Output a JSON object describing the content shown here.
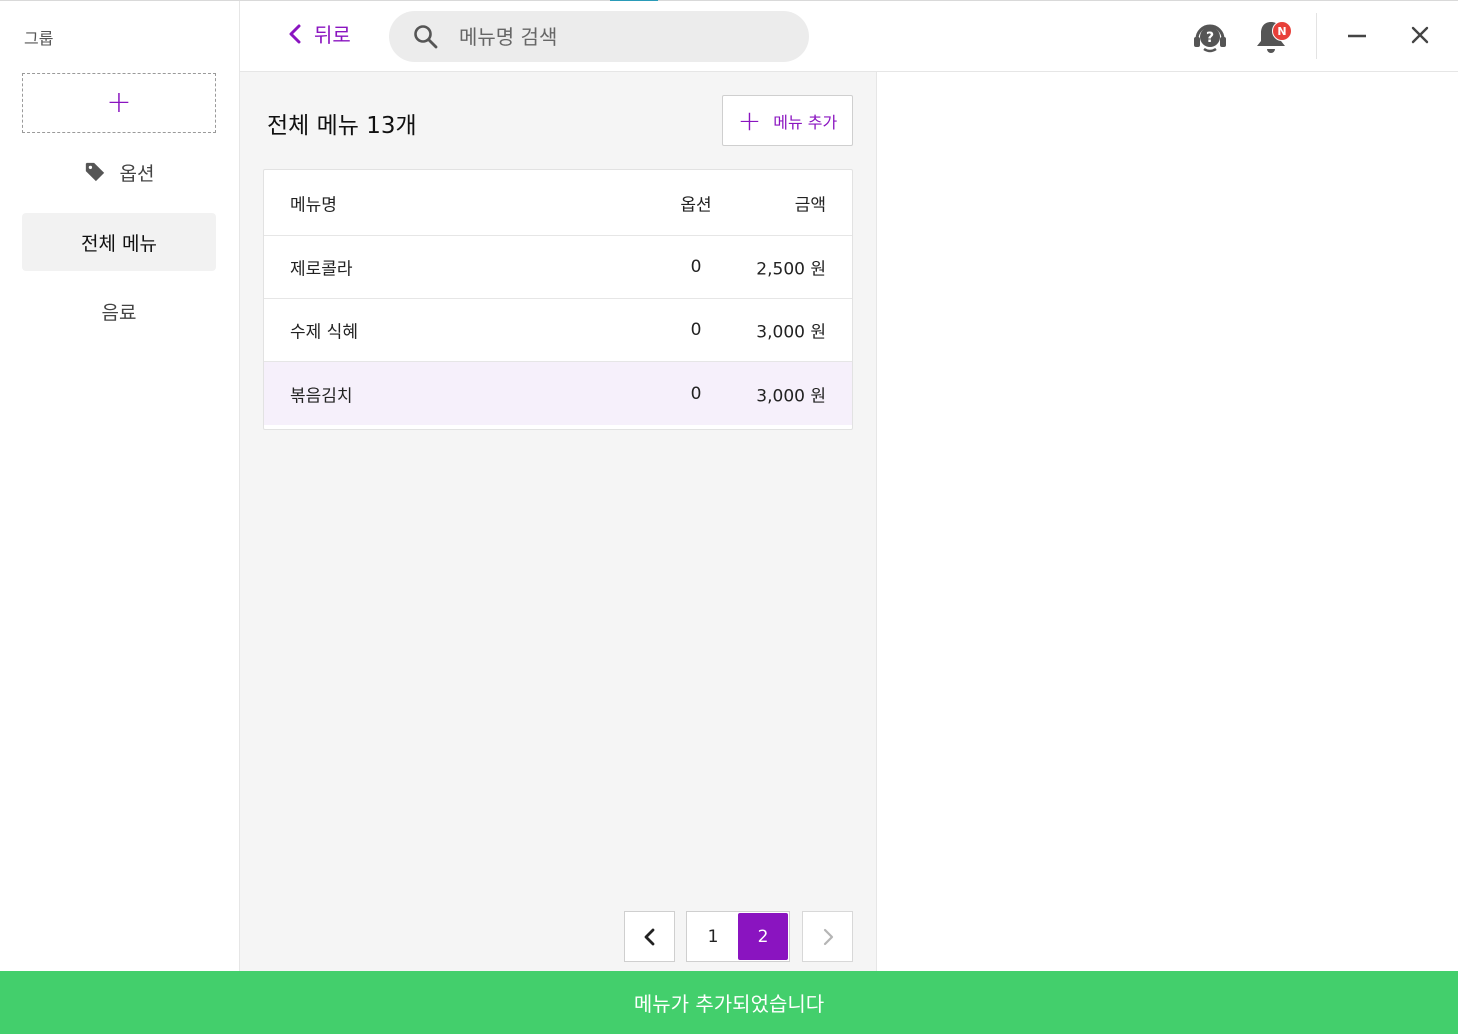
{
  "sidebar": {
    "title": "그룹",
    "add_label": "+",
    "items": [
      {
        "label": "옵션",
        "icon": "tag-icon"
      },
      {
        "label": "전체 메뉴",
        "active": true
      },
      {
        "label": "음료"
      }
    ]
  },
  "topbar": {
    "back_label": "뒤로",
    "search_placeholder": "메뉴명 검색",
    "notification_badge": "N",
    "icons": [
      "help-headset-icon",
      "bell-icon",
      "minimize-icon",
      "close-icon"
    ]
  },
  "main": {
    "title": "전체 메뉴 13개",
    "add_menu_label": "메뉴 추가",
    "table": {
      "headers": {
        "name": "메뉴명",
        "option": "옵션",
        "price": "금액"
      },
      "rows": [
        {
          "name": "제로콜라",
          "option": "0",
          "price": "2,500 원"
        },
        {
          "name": "수제 식혜",
          "option": "0",
          "price": "3,000 원"
        },
        {
          "name": "볶음김치",
          "option": "0",
          "price": "3,000 원"
        }
      ]
    },
    "pagination": {
      "pages": [
        "1",
        "2"
      ],
      "current": "2"
    }
  },
  "toast": {
    "message": "메뉴가 추가되었습니다"
  },
  "colors": {
    "accent": "#8a14c0",
    "toast": "#43cf6c",
    "badge": "#e8403a",
    "highlight_row": "#f6f0fb"
  }
}
